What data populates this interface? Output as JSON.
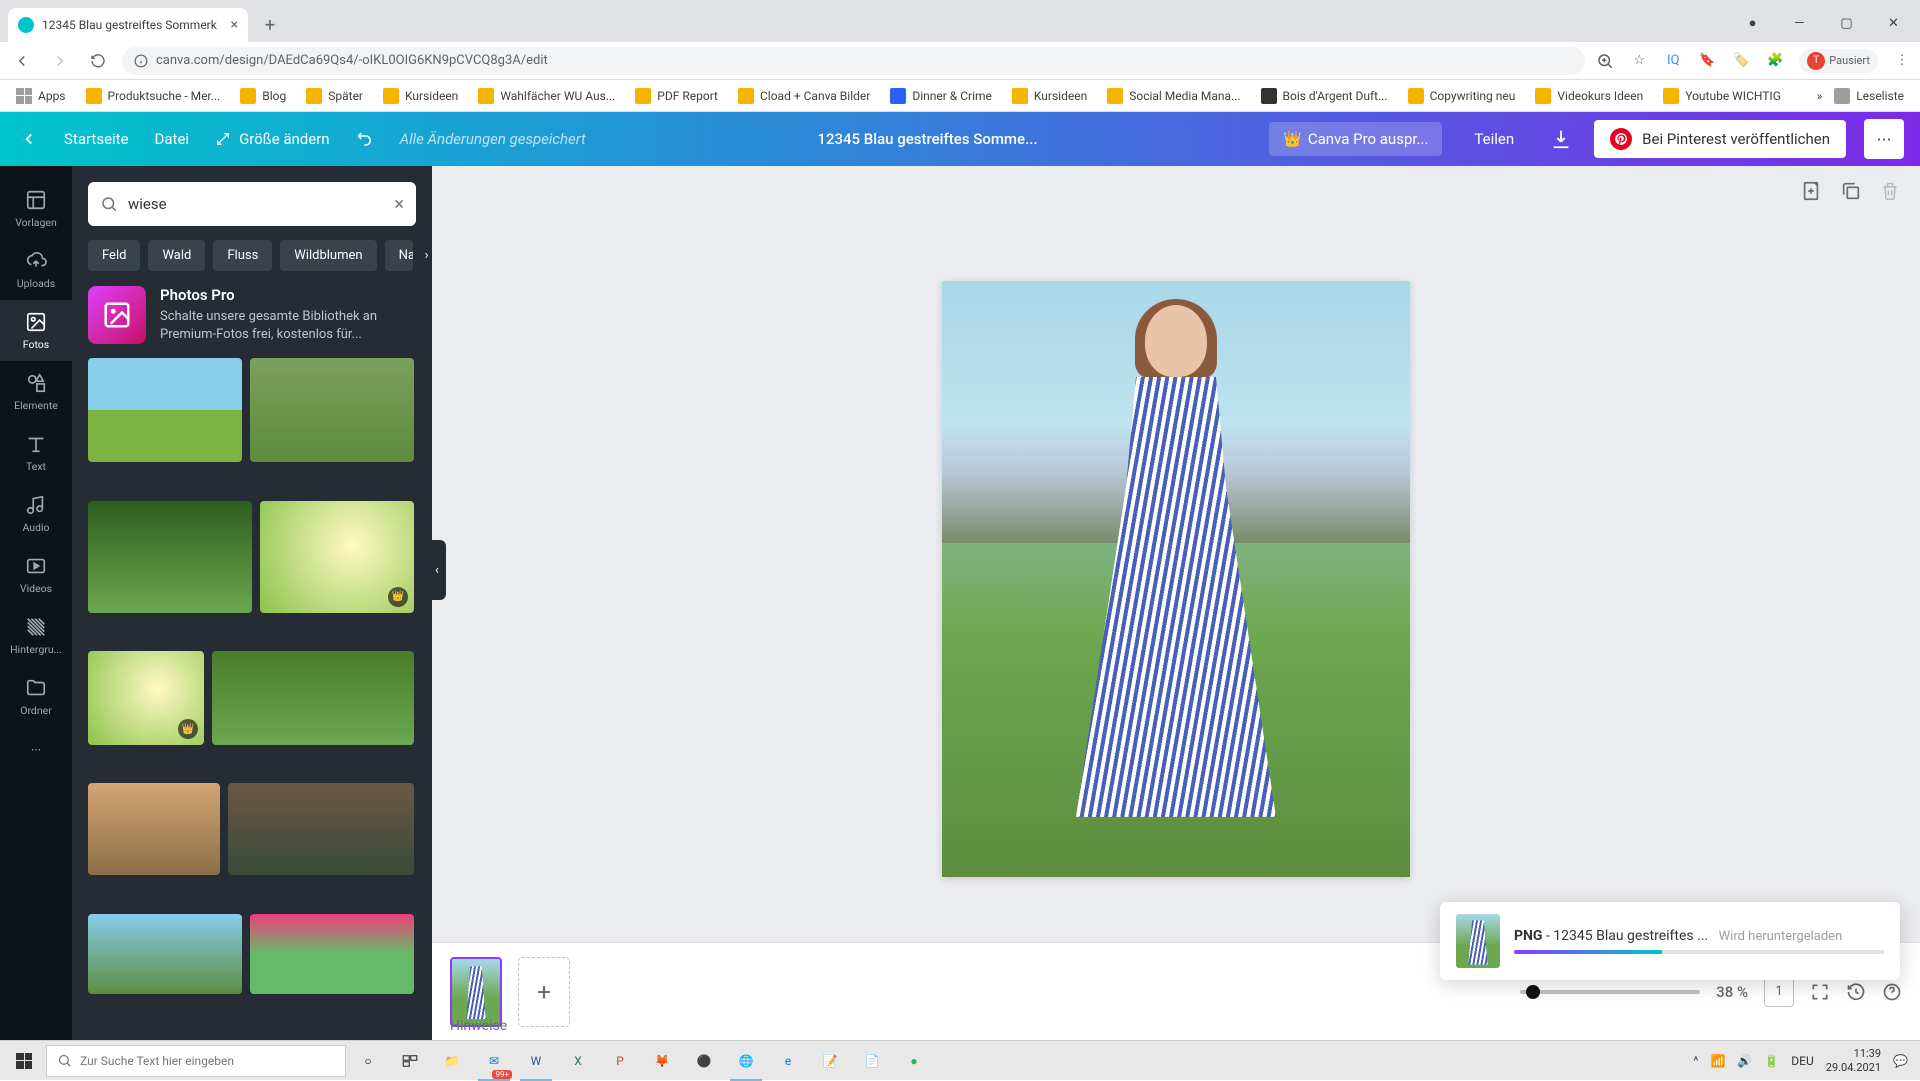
{
  "browser": {
    "tab_title": "12345 Blau gestreiftes Sommerk",
    "url": "canva.com/design/DAEdCa69Qs4/-oIKL0OIG6KN9pCVCQ8g3A/edit",
    "profile_status": "Pausiert"
  },
  "bookmarks": {
    "apps": "Apps",
    "items": [
      "Produktsuche - Mer...",
      "Blog",
      "Später",
      "Kursideen",
      "Wahlfächer WU Aus...",
      "PDF Report",
      "Cload + Canva Bilder",
      "Dinner & Crime",
      "Kursideen",
      "Social Media Mana...",
      "Bois d'Argent Duft...",
      "Copywriting neu",
      "Videokurs Ideen",
      "Youtube WICHTIG"
    ],
    "readlist": "Leseliste"
  },
  "canva_bar": {
    "home": "Startseite",
    "file": "Datei",
    "resize": "Größe ändern",
    "saved": "Alle Änderungen gespeichert",
    "design_title": "12345 Blau gestreiftes Somme...",
    "try_pro": "Canva Pro auspr...",
    "share": "Teilen",
    "pinterest": "Bei Pinterest veröffentlichen"
  },
  "rail": {
    "vorlagen": "Vorlagen",
    "uploads": "Uploads",
    "fotos": "Fotos",
    "elemente": "Elemente",
    "text": "Text",
    "audio": "Audio",
    "videos": "Videos",
    "hintergrund": "Hintergru...",
    "ordner": "Ordner"
  },
  "panel": {
    "search_value": "wiese",
    "chips": [
      "Feld",
      "Wald",
      "Fluss",
      "Wildblumen",
      "Natu"
    ],
    "pro_title": "Photos Pro",
    "pro_desc": "Schalte unsere gesamte Bibliothek an Premium-Fotos frei, kostenlos für..."
  },
  "footer": {
    "hinweise": "Hinweise",
    "zoom": "38 %",
    "page_count": "1"
  },
  "toast": {
    "format": "PNG",
    "sep": " - ",
    "filename": "12345 Blau gestreiftes ...",
    "status": "Wird heruntergeladen"
  },
  "taskbar": {
    "search_placeholder": "Zur Suche Text hier eingeben",
    "badge": "99+",
    "lang": "DEU",
    "time": "11:39",
    "date": "29.04.2021"
  }
}
